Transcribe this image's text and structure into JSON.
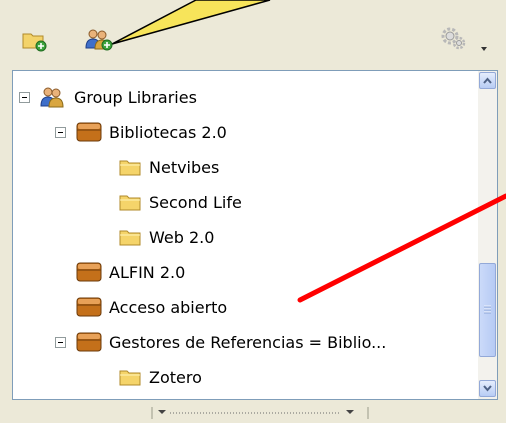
{
  "toolbar": {
    "icons": [
      "new-collection-icon",
      "new-group-icon",
      "actions-gear-icon",
      "chevron-down-icon"
    ]
  },
  "tree": {
    "items": [
      {
        "label": "Group Libraries",
        "icon": "group-icon",
        "expander": "minus"
      },
      {
        "label": "Bibliotecas 2.0",
        "icon": "library-icon",
        "expander": "minus"
      },
      {
        "label": "Netvibes",
        "icon": "folder-icon"
      },
      {
        "label": "Second Life",
        "icon": "folder-icon"
      },
      {
        "label": "Web 2.0",
        "icon": "folder-icon"
      },
      {
        "label": "ALFIN 2.0",
        "icon": "library-icon"
      },
      {
        "label": "Acceso abierto",
        "icon": "library-icon"
      },
      {
        "label": "Gestores de Referencias = Biblio...",
        "icon": "library-icon",
        "expander": "minus"
      },
      {
        "label": "Zotero",
        "icon": "folder-icon"
      }
    ]
  },
  "annotations": {
    "callout_color": "#f7e45a",
    "arrow_color": "#ff0000"
  },
  "colors": {
    "folder": "#f5d46a",
    "library": "#c4701a",
    "scrollbar": "#b9cdf5"
  }
}
